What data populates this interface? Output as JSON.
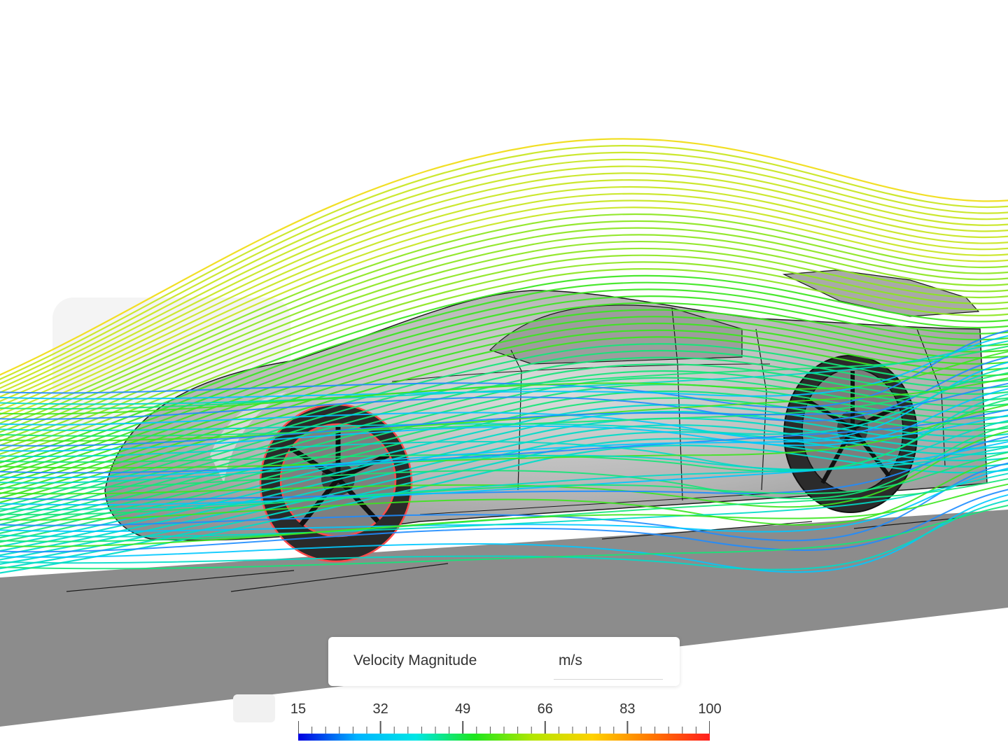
{
  "legend": {
    "title": "Velocity Magnitude",
    "unit": "m/s",
    "min": 15,
    "max": 100,
    "ticks": [
      "15",
      "32",
      "49",
      "66",
      "83",
      "100"
    ],
    "gradient": [
      "#0000e0",
      "#00b4ff",
      "#00e6e6",
      "#1ee61e",
      "#b4e600",
      "#ffd200",
      "#ff7800",
      "#ff1e1e"
    ]
  },
  "scene": {
    "ground_color": "#8c8c8c",
    "body_color": "#b9b9b9",
    "highlight_color": "#ff4a4a"
  }
}
